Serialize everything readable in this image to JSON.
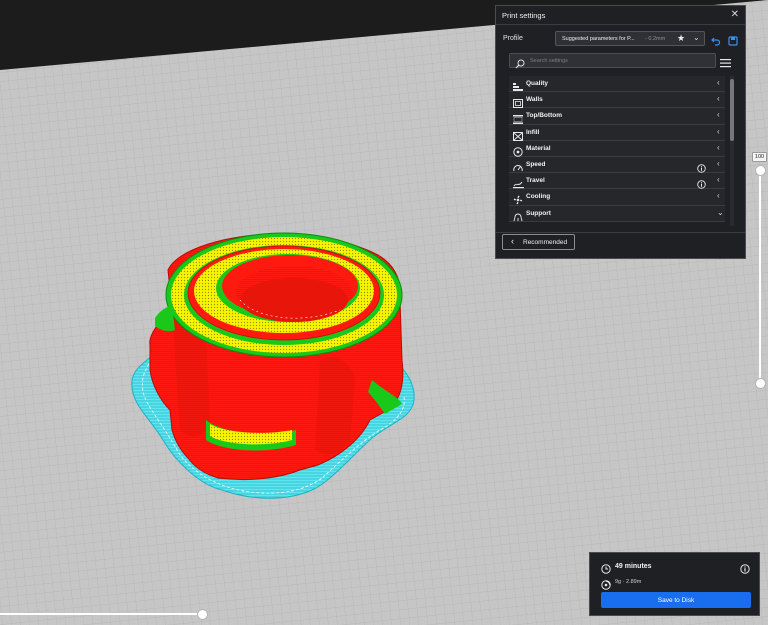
{
  "print_settings": {
    "title": "Print settings",
    "close_glyph": "✕",
    "profile_label": "Profile",
    "profile_name": "Suggested parameters for P...",
    "profile_layer_height": "- 0.2mm",
    "profile_star_glyph": "★",
    "profile_chevron_glyph": "⌄",
    "reset_icon": "undo-icon",
    "save_icon": "save-icon",
    "search_placeholder": "Search settings",
    "menu_icon": "hamburger-icon",
    "categories": [
      {
        "label": "Quality",
        "icon": "quality-icon",
        "chevron": "‹",
        "info": false
      },
      {
        "label": "Walls",
        "icon": "walls-icon",
        "chevron": "‹",
        "info": false
      },
      {
        "label": "Top/Bottom",
        "icon": "top-bottom-icon",
        "chevron": "‹",
        "info": false
      },
      {
        "label": "Infill",
        "icon": "infill-icon",
        "chevron": "‹",
        "info": false
      },
      {
        "label": "Material",
        "icon": "material-icon",
        "chevron": "‹",
        "info": false
      },
      {
        "label": "Speed",
        "icon": "speed-icon",
        "chevron": "‹",
        "info": true
      },
      {
        "label": "Travel",
        "icon": "travel-icon",
        "chevron": "‹",
        "info": true
      },
      {
        "label": "Cooling",
        "icon": "cooling-icon",
        "chevron": "‹",
        "info": false
      },
      {
        "label": "Support",
        "icon": "support-icon",
        "chevron": "⌄",
        "info": false
      }
    ],
    "recommended_chevron": "‹",
    "recommended_label": "Recommended"
  },
  "layer_slider": {
    "current_layer": "100",
    "top_fraction": 1.0,
    "bottom_fraction": 0.0
  },
  "simulation_slider": {
    "progress_fraction": 1.0
  },
  "output": {
    "print_time": "49 minutes",
    "material_usage": "9g · 2.89m",
    "save_label": "Save to Disk",
    "clock_icon": "clock-icon",
    "info_icon": "info-icon",
    "spool_icon": "spool-icon"
  },
  "colors": {
    "accent": "#196ef0",
    "build_plate": "#c3c3c3",
    "background": "#1c1c1c",
    "outer_wall": "#ff1a0f",
    "inner_wall": "#1ac81a",
    "skin": "#f2f200",
    "skirt": "#5ae6f2",
    "panel": "#1f2024"
  }
}
